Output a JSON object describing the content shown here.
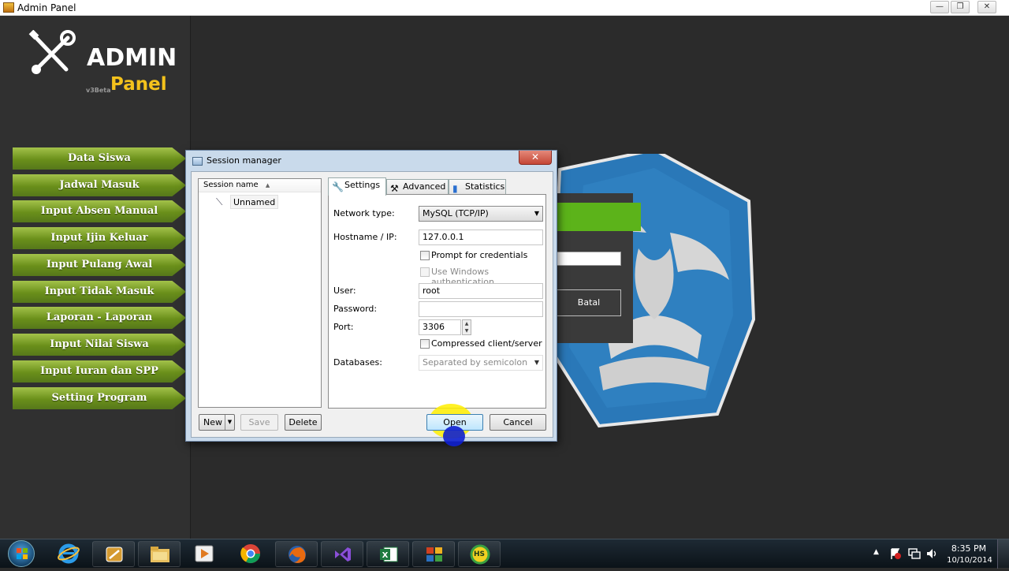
{
  "window": {
    "title": "Admin Panel",
    "controls": {
      "minimize": "—",
      "maximize": "❐",
      "close": "✕"
    }
  },
  "logo": {
    "line1": "ADMIN",
    "version": "v3Beta",
    "line2": "Panel",
    "icon": "tools-icon"
  },
  "sidebar": {
    "items": [
      {
        "label": "Data Siswa"
      },
      {
        "label": "Jadwal Masuk"
      },
      {
        "label": "Input Absen Manual"
      },
      {
        "label": "Input Ijin Keluar"
      },
      {
        "label": "Input Pulang Awal"
      },
      {
        "label": "Input Tidak Masuk"
      },
      {
        "label": "Laporan - Laporan"
      },
      {
        "label": "Input Nilai Siswa"
      },
      {
        "label": "Input Iuran dan SPP"
      },
      {
        "label": "Setting Program"
      }
    ]
  },
  "background_form": {
    "button_label": "Batal"
  },
  "session_manager": {
    "title": "Session manager",
    "close": "✕",
    "list": {
      "header": "Session name",
      "sort_indicator": "▲",
      "items": [
        {
          "name": "Unnamed"
        }
      ]
    },
    "tabs": [
      {
        "label": "Settings",
        "icon": "wrench-icon",
        "active": true
      },
      {
        "label": "Advanced",
        "icon": "tools-icon",
        "active": false
      },
      {
        "label": "Statistics",
        "icon": "bar-chart-icon",
        "active": false
      }
    ],
    "settings": {
      "network_type_label": "Network type:",
      "network_type_value": "MySQL (TCP/IP)",
      "hostname_label": "Hostname / IP:",
      "hostname_value": "127.0.0.1",
      "prompt_credentials_label": "Prompt for credentials",
      "windows_auth_label": "Use Windows authentication",
      "user_label": "User:",
      "user_value": "root",
      "password_label": "Password:",
      "password_value": "",
      "port_label": "Port:",
      "port_value": "3306",
      "compressed_label": "Compressed client/server prc",
      "databases_label": "Databases:",
      "databases_placeholder": "Separated by semicolon"
    },
    "buttons": {
      "new": "New",
      "save": "Save",
      "delete": "Delete",
      "open": "Open",
      "cancel": "Cancel"
    }
  },
  "taskbar": {
    "apps": [
      {
        "name": "internet-explorer-icon",
        "color": "#1f8fe0"
      },
      {
        "name": "admin-tools-icon",
        "color": "#c08a30"
      },
      {
        "name": "file-explorer-icon",
        "color": "#e0b040"
      },
      {
        "name": "media-player-icon",
        "color": "#e07a20"
      },
      {
        "name": "chrome-icon",
        "color": "#e04030"
      },
      {
        "name": "firefox-icon",
        "color": "#e86a10"
      },
      {
        "name": "visual-studio-icon",
        "color": "#6a3aa8"
      },
      {
        "name": "excel-icon",
        "color": "#1e7a3e"
      },
      {
        "name": "app-grid-icon",
        "color": "#d04020"
      },
      {
        "name": "hypersnap-icon",
        "color": "#3aa040"
      }
    ],
    "hypersnap_text": "HS",
    "tray": {
      "expand": "▲",
      "time": "8:35 PM",
      "date": "10/10/2014"
    }
  }
}
